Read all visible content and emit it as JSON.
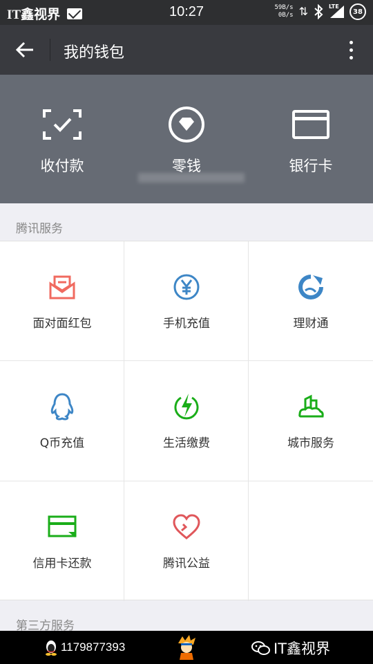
{
  "status_bar": {
    "carrier_text": "IT鑫视界",
    "time": "10:27",
    "net_up": "59B/s",
    "net_down": "0B/s",
    "network": "LTE",
    "battery": "38"
  },
  "title_bar": {
    "title": "我的钱包"
  },
  "wallet_header": {
    "items": [
      {
        "label": "收付款",
        "icon": "scan-check-icon"
      },
      {
        "label": "零钱",
        "icon": "diamond-coin-icon"
      },
      {
        "label": "银行卡",
        "icon": "bank-card-icon"
      }
    ]
  },
  "sections": {
    "tencent_services": "腾讯服务",
    "third_party_services": "第三方服务"
  },
  "services": [
    {
      "label": "面对面红包",
      "icon": "red-packet-icon",
      "color": "#f06a5f"
    },
    {
      "label": "手机充值",
      "icon": "yuan-coin-icon",
      "color": "#3d86c6"
    },
    {
      "label": "理财通",
      "icon": "licaitong-icon",
      "color": "#3d86c6"
    },
    {
      "label": "Q币充值",
      "icon": "qq-penguin-icon",
      "color": "#3d86c6"
    },
    {
      "label": "生活缴费",
      "icon": "lightning-icon",
      "color": "#1aad19"
    },
    {
      "label": "城市服务",
      "icon": "city-icon",
      "color": "#1aad19"
    },
    {
      "label": "信用卡还款",
      "icon": "credit-card-icon",
      "color": "#1aad19"
    },
    {
      "label": "腾讯公益",
      "icon": "charity-heart-icon",
      "color": "#e0575b"
    }
  ],
  "watermark": {
    "qq_number": "1179877393",
    "brand": "IT鑫视界"
  }
}
